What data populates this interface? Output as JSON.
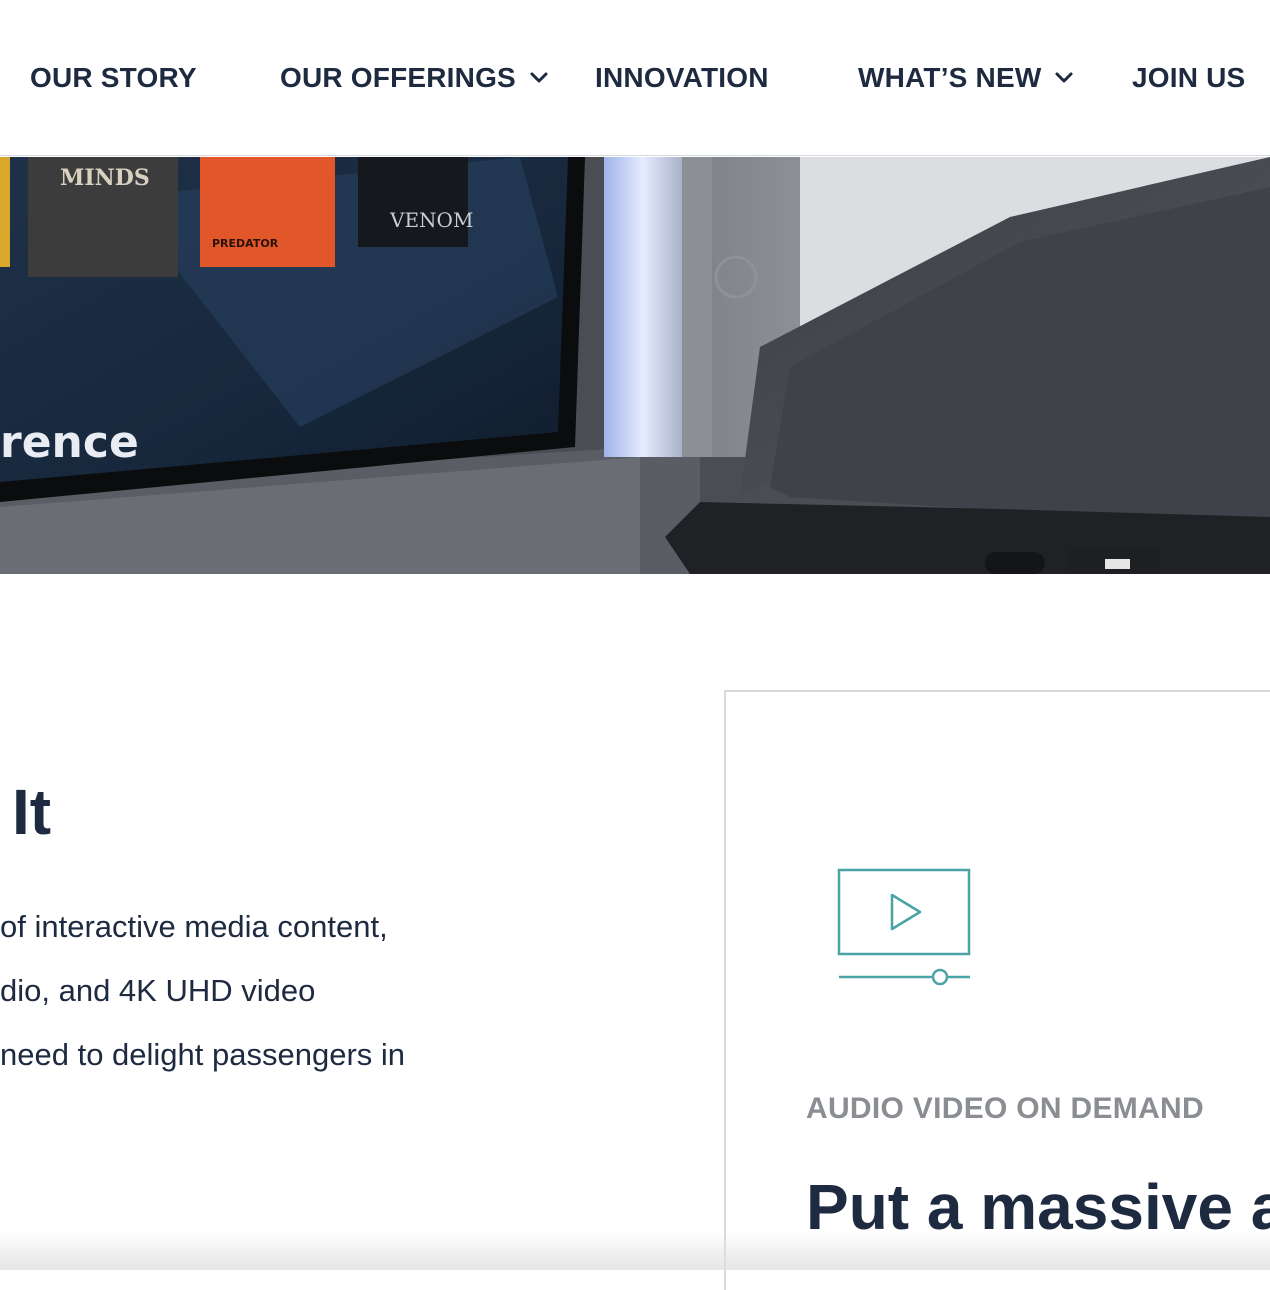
{
  "nav": {
    "items": [
      {
        "label": "OUR STORY",
        "has_dropdown": false
      },
      {
        "label": "OUR OFFERINGS",
        "has_dropdown": true
      },
      {
        "label": "INNOVATION",
        "has_dropdown": false
      },
      {
        "label": "WHAT’S NEW",
        "has_dropdown": true
      },
      {
        "label": "JOIN US",
        "has_dropdown": false
      }
    ]
  },
  "hero": {
    "screen_text": "rence",
    "poster_titles": [
      "MINDS",
      "PREDATOR",
      "VENOM"
    ]
  },
  "section": {
    "headline": "It",
    "paragraph_lines": [
      "of interactive media content,",
      "dio, and 4K UHD video",
      "need to delight passengers in"
    ]
  },
  "card": {
    "icon": "play-video-icon",
    "eyebrow": "AUDIO VIDEO ON DEMAND",
    "title": "Put a massive a"
  },
  "colors": {
    "navy": "#1d2a40",
    "teal_icon": "#4aa3a5",
    "gray_text": "#8a8d92",
    "border": "#d6d9de"
  }
}
